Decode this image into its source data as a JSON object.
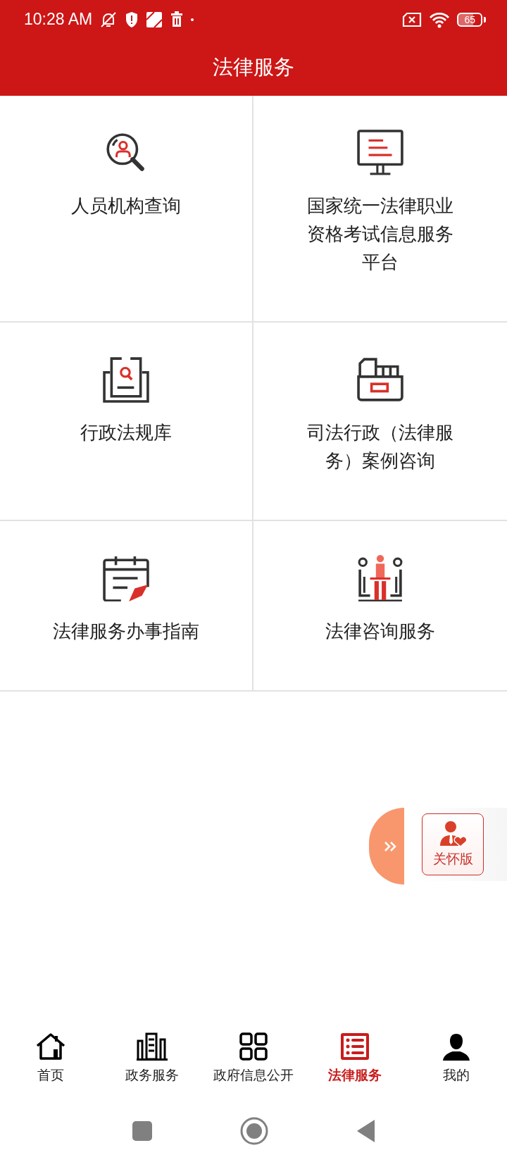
{
  "status_bar": {
    "time": "10:28 AM",
    "battery": "65"
  },
  "header": {
    "title": "法律服务"
  },
  "services": [
    {
      "kind": "person-search",
      "label": "人员机构查询"
    },
    {
      "kind": "monitor",
      "label": "国家统一法律职业资格考试信息服务平台"
    },
    {
      "kind": "doc-search",
      "label": "行政法规库"
    },
    {
      "kind": "file-box",
      "label": "司法行政（法律服务）案例咨询"
    },
    {
      "kind": "calendar-pen",
      "label": "法律服务办事指南"
    },
    {
      "kind": "meeting",
      "label": "法律咨询服务"
    }
  ],
  "care_mode": {
    "label": "关怀版"
  },
  "tabs": [
    {
      "kind": "home",
      "label": "首页",
      "selected": false
    },
    {
      "kind": "building",
      "label": "政务服务",
      "selected": false
    },
    {
      "kind": "grid",
      "label": "政府信息公开",
      "selected": false
    },
    {
      "kind": "list",
      "label": "法律服务",
      "selected": true
    },
    {
      "kind": "person",
      "label": "我的",
      "selected": false
    }
  ]
}
